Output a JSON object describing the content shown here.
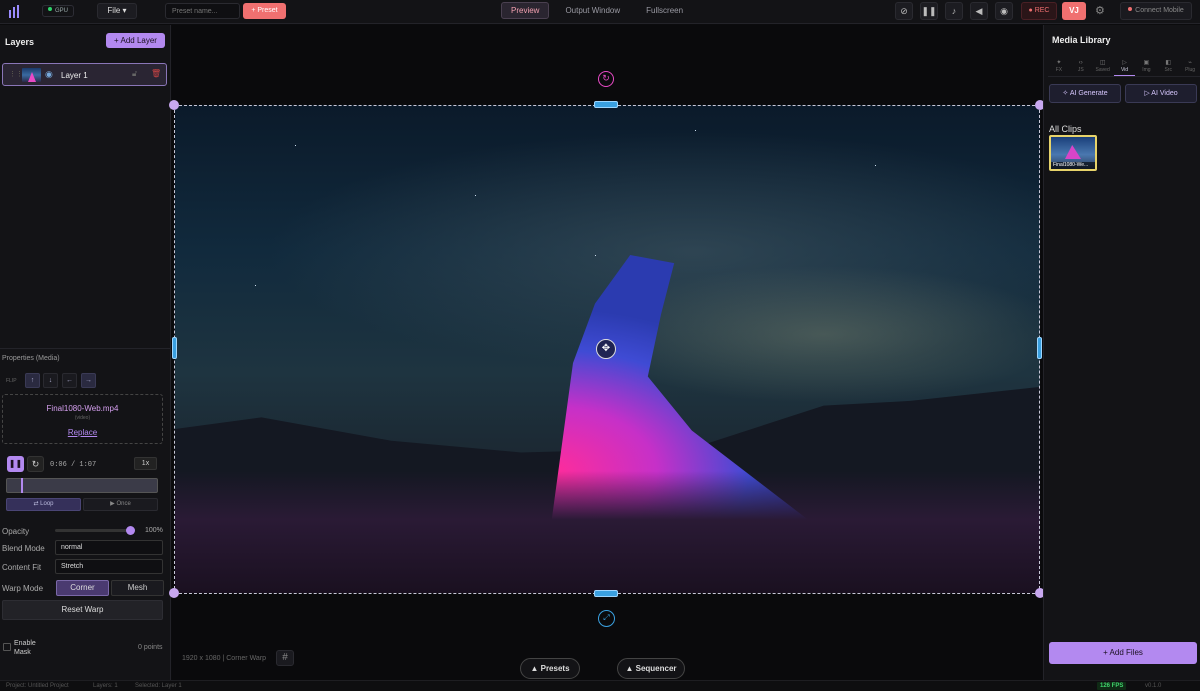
{
  "topbar": {
    "gpu_label": "GPU",
    "file_menu": "File",
    "preset_placeholder": "Preset name...",
    "preset_button": "+ Preset",
    "view_tabs": [
      {
        "label": "Preview",
        "active": true
      },
      {
        "label": "Output Window",
        "active": false
      },
      {
        "label": "Fullscreen",
        "active": false
      }
    ],
    "rec_button": "● REC",
    "vj_button": "VJ",
    "connect_mobile": "Connect Mobile"
  },
  "layers": {
    "title": "Layers",
    "add_button": "+ Add Layer",
    "items": [
      {
        "name": "Layer 1",
        "selected": true
      }
    ]
  },
  "properties": {
    "title": "Properties (Media)",
    "flip_label": "FLIP",
    "flip_buttons": [
      "↑",
      "↓",
      "←",
      "→"
    ],
    "media_name": "Final1080-Web.mp4",
    "media_type": "(video)",
    "replace_label": "Replace",
    "time": "0:06 / 1:07",
    "speed": "1x",
    "playback_position": 0.09,
    "loop_label": "Loop",
    "once_label": "Once",
    "opacity_label": "Opacity",
    "opacity_value": "100%",
    "blend_label": "Blend Mode",
    "blend_value": "normal",
    "fit_label": "Content Fit",
    "fit_value": "Stretch",
    "warp_label": "Warp Mode",
    "warp_corner": "Corner",
    "warp_mesh": "Mesh",
    "reset_warp": "Reset Warp",
    "mask_label": "Enable Mask",
    "mask_points": "0 points"
  },
  "canvas": {
    "info": "1920 x 1080 | Corner Warp",
    "presets_button": "Presets",
    "sequencer_button": "Sequencer"
  },
  "media_library": {
    "title": "Media Library",
    "tabs": [
      {
        "label": "FX",
        "active": false
      },
      {
        "label": "JS",
        "active": false
      },
      {
        "label": "Saved",
        "active": false
      },
      {
        "label": "Vid",
        "active": true
      },
      {
        "label": "Img",
        "active": false
      },
      {
        "label": "Src",
        "active": false
      },
      {
        "label": "Plug",
        "active": false
      }
    ],
    "ai_generate": "AI Generate",
    "ai_video": "AI Video",
    "all_clips": "All Clips",
    "clips": [
      {
        "name": "Final1080-We..."
      }
    ],
    "add_files": "Add Files"
  },
  "status": {
    "project": "Project: Untitled Project",
    "layers": "Layers: 1",
    "selected": "Selected: Layer 1",
    "fps": "126 FPS",
    "version": "v0.1.0"
  },
  "colors": {
    "accent": "#b389f0",
    "rec": "#f07070",
    "handle": "#3aa0e0",
    "fps": "#3fd36b"
  }
}
